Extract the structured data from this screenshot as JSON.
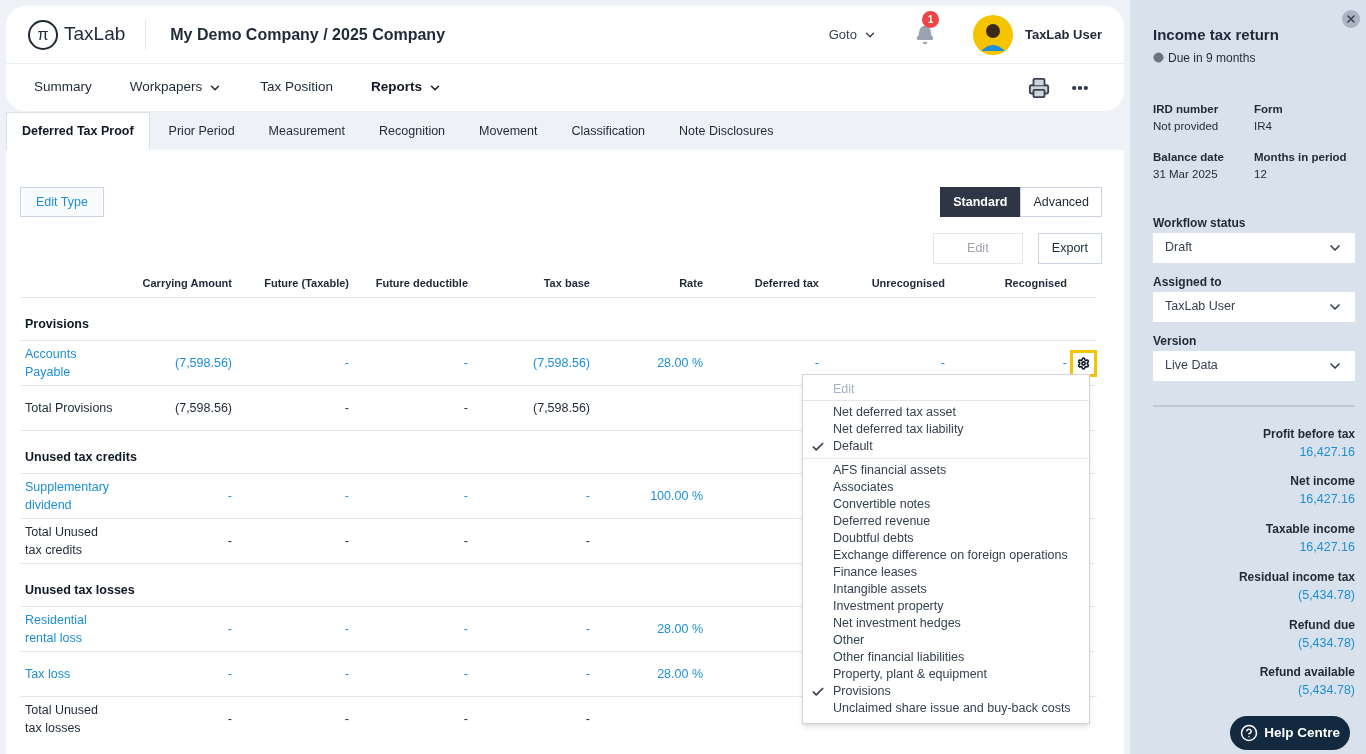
{
  "header": {
    "logo": {
      "mark": "π",
      "name": "TaxLab"
    },
    "company": "My Demo Company / 2025 Company",
    "goto": "Goto",
    "notifications": "1",
    "user": "TaxLab User"
  },
  "nav": [
    {
      "label": "Summary",
      "dropdown": false,
      "selected": false
    },
    {
      "label": "Workpapers",
      "dropdown": true,
      "selected": false
    },
    {
      "label": "Tax Position",
      "dropdown": false,
      "selected": false
    },
    {
      "label": "Reports",
      "dropdown": true,
      "selected": true
    }
  ],
  "tabs": [
    {
      "label": "Deferred Tax Proof",
      "selected": true
    },
    {
      "label": "Prior Period",
      "selected": false
    },
    {
      "label": "Measurement",
      "selected": false
    },
    {
      "label": "Recognition",
      "selected": false
    },
    {
      "label": "Movement",
      "selected": false
    },
    {
      "label": "Classification",
      "selected": false
    },
    {
      "label": "Note Disclosures",
      "selected": false
    }
  ],
  "toolbar": {
    "edit_type": "Edit Type",
    "view_toggle": [
      {
        "label": "Standard",
        "selected": true
      },
      {
        "label": "Advanced",
        "selected": false
      }
    ],
    "edit": {
      "label": "Edit",
      "disabled": true
    },
    "export": "Export"
  },
  "table": {
    "columns": [
      "Carrying Amount",
      "Future (Taxable)",
      "Future deductible",
      "Tax base",
      "Rate",
      "Deferred tax",
      "Unrecognised",
      "Recognised"
    ],
    "sections": [
      {
        "title": "Provisions",
        "rows": [
          {
            "kind": "link",
            "label": "Accounts Payable",
            "cells": [
              "(7,598.56)",
              "-",
              "-",
              "(7,598.56)",
              "28.00 %",
              "-",
              "-",
              "-"
            ],
            "settings": true
          },
          {
            "kind": "total",
            "label": "Total Provisions",
            "cells": [
              "(7,598.56)",
              "-",
              "-",
              "(7,598.56)"
            ]
          }
        ]
      },
      {
        "title": "Unused tax credits",
        "rows": [
          {
            "kind": "link",
            "label": "Supplementary dividend",
            "cells": [
              "-",
              "-",
              "-",
              "-",
              "100.00 %"
            ]
          },
          {
            "kind": "total",
            "label": "Total Unused tax credits",
            "cells": [
              "-",
              "-",
              "-",
              "-"
            ]
          }
        ]
      },
      {
        "title": "Unused tax losses",
        "rows": [
          {
            "kind": "link",
            "label": "Residential rental loss",
            "cells": [
              "-",
              "-",
              "-",
              "-",
              "28.00 %"
            ]
          },
          {
            "kind": "link",
            "label": "Tax loss",
            "cells": [
              "-",
              "-",
              "-",
              "-",
              "28.00 %"
            ]
          },
          {
            "kind": "total",
            "label": "Total Unused tax losses",
            "cells": [
              "-",
              "-",
              "-",
              "-"
            ]
          }
        ]
      }
    ]
  },
  "menu": {
    "title": "Edit",
    "groups": [
      [
        {
          "label": "Net deferred tax asset",
          "checked": false
        },
        {
          "label": "Net deferred tax liability",
          "checked": false
        },
        {
          "label": "Default",
          "checked": true
        }
      ],
      [
        {
          "label": "AFS financial assets",
          "checked": false
        },
        {
          "label": "Associates",
          "checked": false
        },
        {
          "label": "Convertible notes",
          "checked": false
        },
        {
          "label": "Deferred revenue",
          "checked": false
        },
        {
          "label": "Doubtful debts",
          "checked": false
        },
        {
          "label": "Exchange difference on foreign operations",
          "checked": false
        },
        {
          "label": "Finance leases",
          "checked": false
        },
        {
          "label": "Intangible assets",
          "checked": false
        },
        {
          "label": "Investment property",
          "checked": false
        },
        {
          "label": "Net investment hedges",
          "checked": false
        },
        {
          "label": "Other",
          "checked": false
        },
        {
          "label": "Other financial liabilities",
          "checked": false
        },
        {
          "label": "Property, plant & equipment",
          "checked": false
        },
        {
          "label": "Provisions",
          "checked": true
        },
        {
          "label": "Unclaimed share issue and buy-back costs",
          "checked": false
        }
      ]
    ]
  },
  "side_panel": {
    "title": "Income tax return",
    "due": "Due in 9 months",
    "facts": [
      {
        "label": "IRD number",
        "value": "Not provided"
      },
      {
        "label": "Form",
        "value": "IR4"
      },
      {
        "label": "Balance date",
        "value": "31 Mar 2025"
      },
      {
        "label": "Months in period",
        "value": "12"
      }
    ],
    "selects": [
      {
        "label": "Workflow status",
        "value": "Draft"
      },
      {
        "label": "Assigned to",
        "value": "TaxLab User"
      },
      {
        "label": "Version",
        "value": "Live Data"
      }
    ],
    "summary": [
      {
        "label": "Profit before tax",
        "value": "16,427.16"
      },
      {
        "label": "Net income",
        "value": "16,427.16"
      },
      {
        "label": "Taxable income",
        "value": "16,427.16"
      },
      {
        "label": "Residual income tax",
        "value": "(5,434.78)"
      },
      {
        "label": "Refund due",
        "value": "(5,434.78)"
      },
      {
        "label": "Refund available",
        "value": "(5,434.78)"
      }
    ]
  },
  "help": "Help Centre"
}
